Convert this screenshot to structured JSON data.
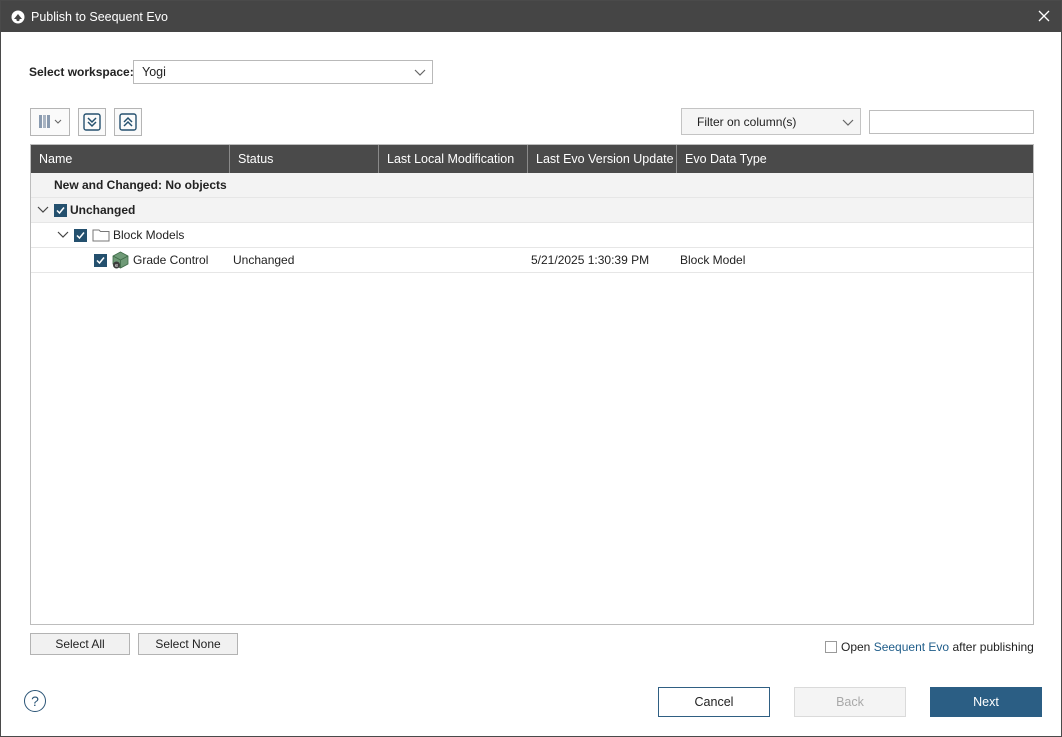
{
  "window": {
    "title": "Publish to Seequent Evo"
  },
  "workspace": {
    "label": "Select workspace:",
    "value": "Yogi"
  },
  "filter": {
    "label": "Filter on column(s)",
    "search_value": ""
  },
  "columns": [
    "Name",
    "Status",
    "Last Local Modification",
    "Last Evo Version Update",
    "Evo Data Type"
  ],
  "rows": {
    "new_changed": "New and Changed: No objects",
    "unchanged_group": "Unchanged",
    "folder": "Block Models",
    "item": {
      "name": "Grade Control",
      "status": "Unchanged",
      "last_local_modification": "",
      "last_evo_version_update": "5/21/2025 1:30:39 PM",
      "evo_data_type": "Block Model"
    }
  },
  "buttons": {
    "select_all": "Select All",
    "select_none": "Select None",
    "cancel": "Cancel",
    "back": "Back",
    "next": "Next"
  },
  "open_after": {
    "prefix": "Open ",
    "link": "Seequent Evo",
    "suffix": " after publishing",
    "checked": false
  },
  "colors": {
    "titlebar": "#454545",
    "header": "#4a4a4a",
    "accent": "#2b5e84",
    "checkbox": "#24506e"
  },
  "icons": [
    "app-logo-icon",
    "close-icon",
    "columns-icon",
    "expand-all-icon",
    "collapse-all-icon",
    "chevron-down-icon",
    "folder-icon",
    "block-model-icon",
    "help-icon",
    "checkmark-icon"
  ]
}
